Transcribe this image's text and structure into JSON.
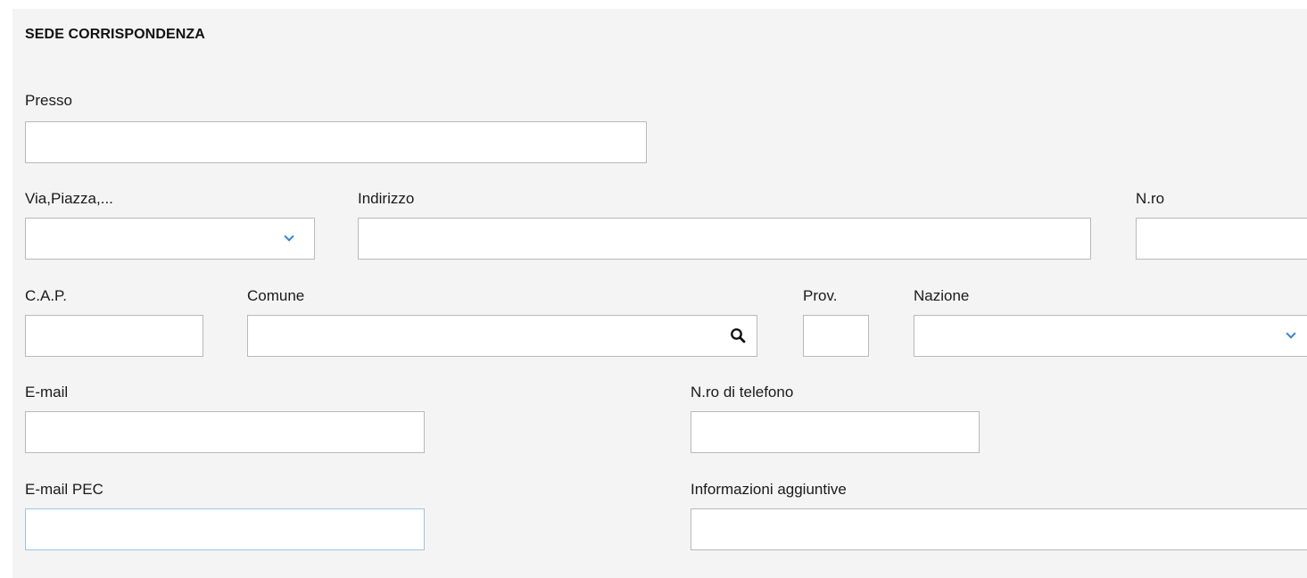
{
  "section": {
    "title": "SEDE CORRISPONDENZA"
  },
  "fields": {
    "presso": {
      "label": "Presso",
      "value": ""
    },
    "via_piazza": {
      "label": "Via,Piazza,...",
      "value": ""
    },
    "indirizzo": {
      "label": "Indirizzo",
      "value": ""
    },
    "numero": {
      "label": "N.ro",
      "value": ""
    },
    "cap": {
      "label": "C.A.P.",
      "value": ""
    },
    "comune": {
      "label": "Comune",
      "value": ""
    },
    "provincia": {
      "label": "Prov.",
      "value": ""
    },
    "nazione": {
      "label": "Nazione",
      "value": ""
    },
    "email": {
      "label": "E-mail",
      "value": ""
    },
    "telefono": {
      "label": "N.ro di telefono",
      "value": ""
    },
    "email_pec": {
      "label": "E-mail PEC",
      "value": ""
    },
    "info_aggiuntive": {
      "label": "Informazioni aggiuntive",
      "value": ""
    }
  },
  "icons": {
    "dropdown": "chevron-down-icon",
    "search": "search-icon"
  },
  "colors": {
    "panel_background": "#f4f4f4",
    "field_border": "#b9b9b9",
    "focus_border": "#9ec4e6",
    "chevron": "#2f86d6"
  }
}
